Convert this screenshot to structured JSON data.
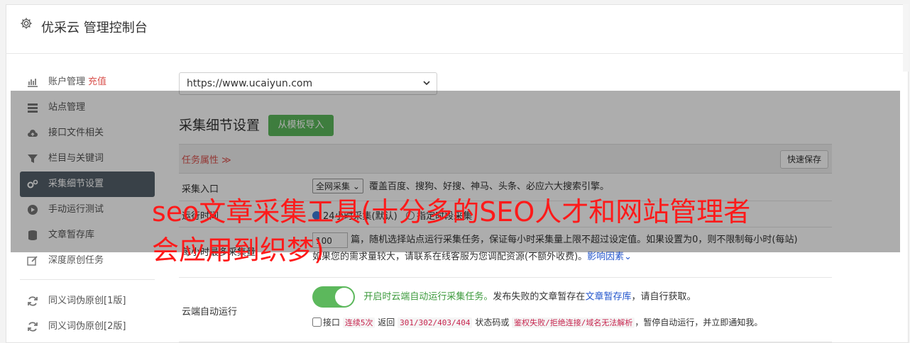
{
  "header": {
    "title": "优采云 管理控制台",
    "icon": "gear-icon"
  },
  "sidebar": {
    "items": [
      {
        "label": "账户管理",
        "badge": "充值",
        "icon": "bar-chart-icon"
      },
      {
        "label": "站点管理",
        "icon": "server-icon"
      },
      {
        "label": "接口文件相关",
        "icon": "cloud-upload-icon"
      },
      {
        "label": "栏目与关键词",
        "icon": "filter-icon"
      },
      {
        "label": "采集细节设置",
        "icon": "gears-icon",
        "active": true
      },
      {
        "label": "手动运行测试",
        "icon": "play-circle-icon"
      },
      {
        "label": "文章暂存库",
        "icon": "database-icon"
      },
      {
        "label": "深度原创任务",
        "icon": "edit-icon"
      }
    ],
    "extra_items": [
      {
        "label": "同义词伪原创[1版]",
        "icon": "refresh-icon"
      },
      {
        "label": "同义词伪原创[2版]",
        "icon": "refresh-icon"
      }
    ]
  },
  "site_select": {
    "value": "https://www.ucaiyun.com"
  },
  "section": {
    "title": "采集细节设置",
    "import_button": "从模板导入"
  },
  "table": {
    "header": {
      "task_attr": "任务属性 ≫",
      "save_button": "快速保存"
    },
    "rows": {
      "collect_entry": {
        "label": "采集入口",
        "select_value": "全网采集",
        "description": "覆盖百度、搜狗、好搜、神马、头条、必应六大搜索引擎。"
      },
      "run_time": {
        "label": "运行时间",
        "option1": "24小时采集(默认)",
        "option2": "指定时段采集"
      },
      "collect_count": {
        "label": "每小时最多采集量",
        "input_value": "100",
        "text1": "篇，随机选择站点运行采集任务，保证每小时采集量上限不超过设定值。如果设置为0，则不限制每小时(每站)",
        "text2": "如果您的需求量较大，请联系在线客服为您调配资源(不额外收费)。",
        "link": "影响因素"
      },
      "cloud_run": {
        "label": "云端自动运行",
        "toggle_text": "开启时云端自动运行采集任务。",
        "text_a": "发布失败的文章暂存在",
        "link": "文章暂存库",
        "text_b": "，请自行获取。",
        "checkbox_label": "接口",
        "code1": "连续5次",
        "text_c": "返回",
        "code2": "301/302/403/404",
        "text_d": "状态码或",
        "code3": "鉴权失败/拒绝连接/域名无法解析",
        "text_e": "，暂停自动运行，并立即通知我。"
      }
    }
  },
  "overlay_title": "seo文章采集工具(十分多的SEO人才和网站管理者会应用到织梦)"
}
